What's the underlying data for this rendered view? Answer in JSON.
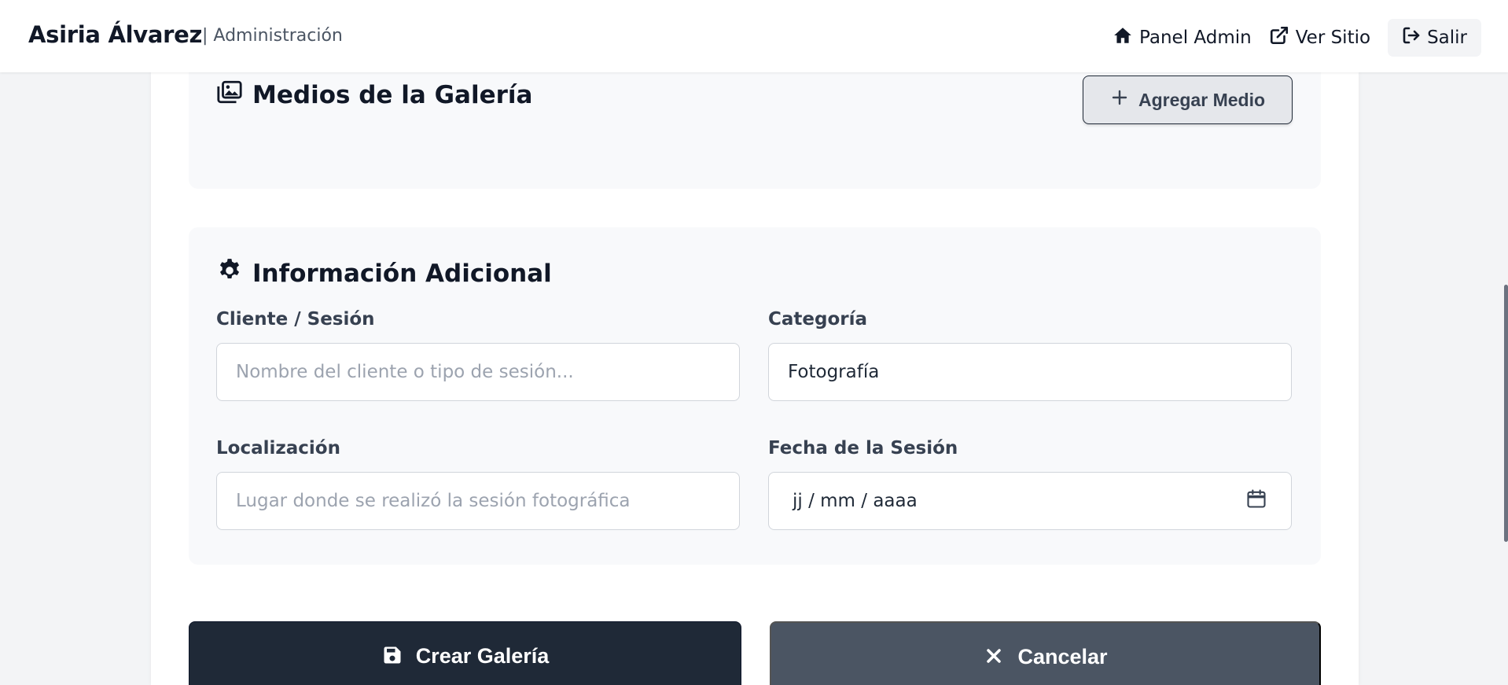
{
  "header": {
    "brand": "Asiria Álvarez",
    "subtitle": "| Administración",
    "nav": {
      "panel_admin": "Panel Admin",
      "ver_sitio": "Ver Sitio",
      "salir": "Salir"
    }
  },
  "media_section": {
    "title": "Medios de la Galería",
    "add_button": "Agregar Medio"
  },
  "info_section": {
    "title": "Información Adicional",
    "cliente": {
      "label": "Cliente / Sesión",
      "placeholder": "Nombre del cliente o tipo de sesión...",
      "value": ""
    },
    "categoria": {
      "label": "Categoría",
      "value": "Fotografía"
    },
    "localizacion": {
      "label": "Localización",
      "placeholder": "Lugar donde se realizó la sesión fotográfica",
      "value": ""
    },
    "fecha": {
      "label": "Fecha de la Sesión",
      "placeholder": "jj / mm / aaaa"
    }
  },
  "actions": {
    "create": "Crear Galería",
    "cancel": "Cancelar"
  },
  "colors": {
    "primary_dark": "#1f2937",
    "secondary_gray": "#4b5563",
    "section_bg": "#f8f9fb",
    "page_bg": "#f3f4f6"
  },
  "icons": {
    "panel_admin": "home-icon",
    "ver_sitio": "external-link-icon",
    "salir": "logout-icon",
    "media_title": "images-icon",
    "add_button": "plus-icon",
    "info_title": "gear-icon",
    "fecha": "calendar-icon",
    "create": "save-icon",
    "cancel": "close-icon"
  }
}
